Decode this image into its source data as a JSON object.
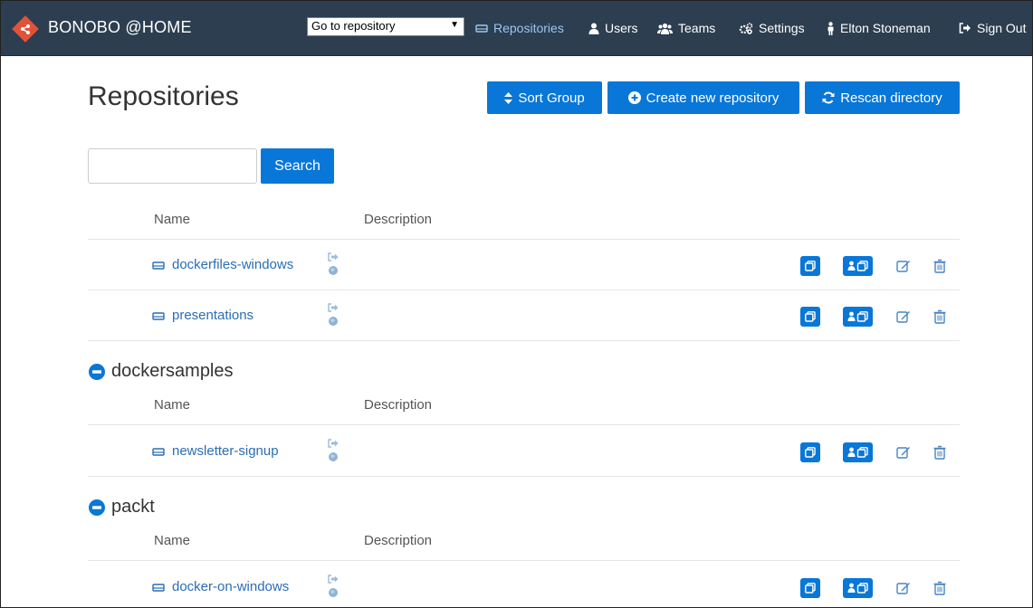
{
  "header": {
    "brand": "BONOBO @HOME",
    "repo_select": "Go to repository",
    "nav": {
      "repositories": "Repositories",
      "users": "Users",
      "teams": "Teams",
      "settings": "Settings",
      "user": "Elton Stoneman",
      "signout": "Sign Out"
    }
  },
  "page": {
    "title": "Repositories",
    "buttons": {
      "sort_group": "Sort Group",
      "create": "Create new repository",
      "rescan": "Rescan directory"
    },
    "search_label": "Search",
    "search_value": ""
  },
  "columns": {
    "name": "Name",
    "description": "Description"
  },
  "groups": [
    {
      "title": "",
      "repos": [
        {
          "name": "dockerfiles-windows",
          "description": ""
        },
        {
          "name": "presentations",
          "description": ""
        }
      ]
    },
    {
      "title": "dockersamples",
      "repos": [
        {
          "name": "newsletter-signup",
          "description": ""
        }
      ]
    },
    {
      "title": "packt",
      "repos": [
        {
          "name": "docker-on-windows",
          "description": ""
        }
      ]
    }
  ],
  "colors": {
    "header_bg": "#2c3e50",
    "accent": "#0877d8",
    "link": "#2a6db5",
    "logo": "#e0533a"
  },
  "icons": {
    "logo": "git-diamond-icon",
    "repo": "hdd-icon",
    "user": "user-icon",
    "teams": "group-icon",
    "settings": "cogs-icon",
    "signout": "sign-out-icon",
    "sort": "sort-icon",
    "create": "plus-circle-icon",
    "rescan": "refresh-icon",
    "collapse": "minus-circle-icon"
  }
}
